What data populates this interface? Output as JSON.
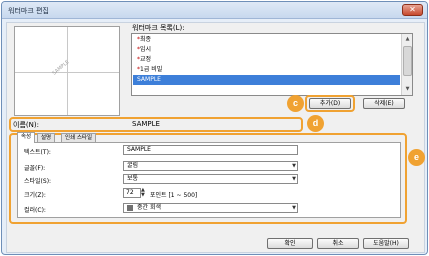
{
  "window": {
    "title": "워터마크 편집",
    "close_glyph": "✕"
  },
  "preview": {
    "watermark_text": "SAMPLE"
  },
  "watermark_list": {
    "label": "워터마크 목록(L):",
    "items": [
      {
        "label": "최종",
        "required": true
      },
      {
        "label": "임시",
        "required": true
      },
      {
        "label": "교정",
        "required": true
      },
      {
        "label": "1급 비밀",
        "required": true
      },
      {
        "label": "SAMPLE",
        "required": false,
        "selected": true
      }
    ],
    "required_mark": "*",
    "scroll_up_glyph": "▲",
    "scroll_down_glyph": "▼"
  },
  "buttons": {
    "add": "추가(D)",
    "delete": "삭제(E)",
    "ok": "확인",
    "cancel": "취소",
    "help": "도움말(H)"
  },
  "markers": {
    "c": "c",
    "d": "d",
    "e": "e"
  },
  "name_field": {
    "label": "이름(N):",
    "value": "SAMPLE"
  },
  "tabs": [
    {
      "label": "속성",
      "active": true
    },
    {
      "label": "설명",
      "active": false
    },
    {
      "label": "인쇄 스타일",
      "active": false
    }
  ],
  "attributes": {
    "text": {
      "label": "텍스트(T):",
      "value": "SAMPLE"
    },
    "font": {
      "label": "글꼴(F):",
      "value": "굴림"
    },
    "style": {
      "label": "스타일(S):",
      "value": "보통"
    },
    "size": {
      "label": "크기(Z):",
      "value": "72",
      "unit": "포인트 [1 ~ 500]"
    },
    "color": {
      "label": "컬러(C):",
      "value": "중간 회색",
      "swatch": "#707070"
    },
    "dropdown_glyph": "▼",
    "spin_up_glyph": "▲",
    "spin_down_glyph": "▼"
  },
  "colors": {
    "accent": "#f0a232",
    "selection": "#3d7fd9",
    "title_bar": "#c7d8ee",
    "required_mark": "#c00000"
  }
}
